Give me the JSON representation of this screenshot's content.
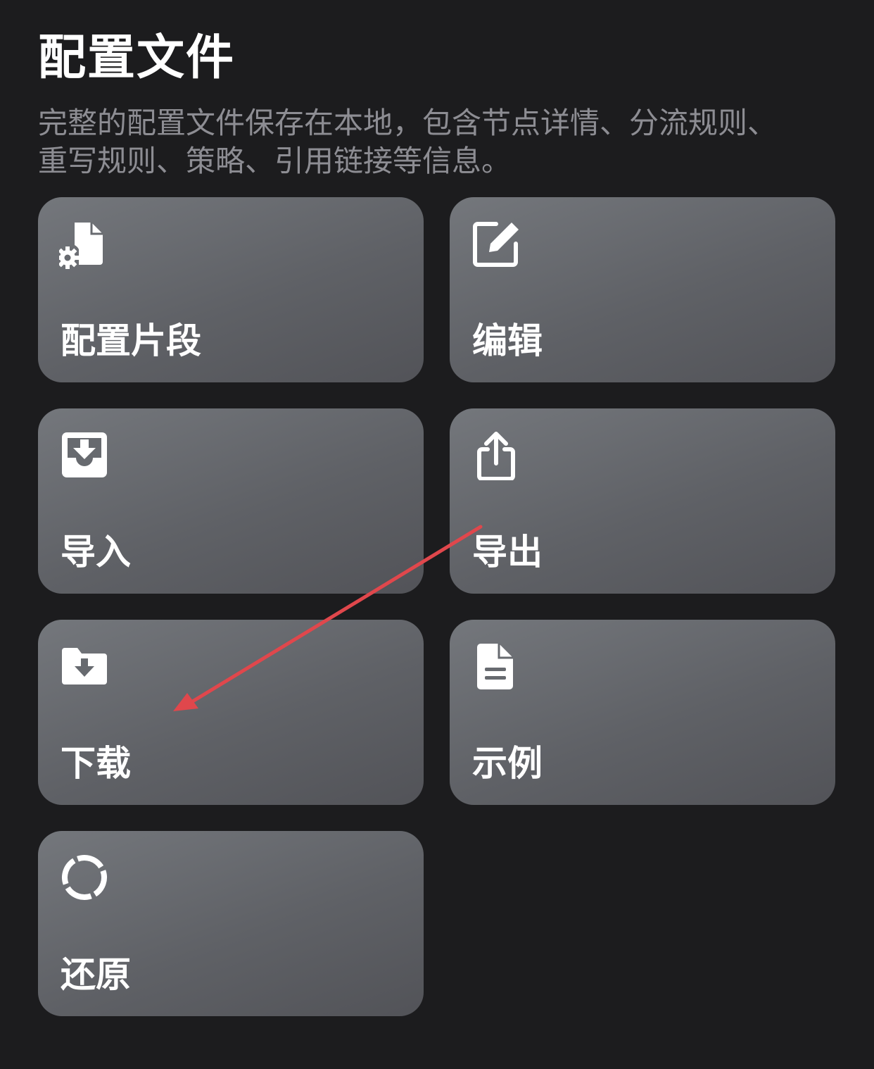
{
  "header": {
    "title": "配置文件",
    "description": "完整的配置文件保存在本地，包含节点详情、分流规则、重写规则、策略、引用链接等信息。"
  },
  "tiles": [
    {
      "label": "配置片段",
      "icon": "file-gear-icon"
    },
    {
      "label": "编辑",
      "icon": "edit-icon"
    },
    {
      "label": "导入",
      "icon": "tray-download-icon"
    },
    {
      "label": "导出",
      "icon": "share-icon"
    },
    {
      "label": "下载",
      "icon": "folder-download-icon"
    },
    {
      "label": "示例",
      "icon": "document-icon"
    },
    {
      "label": "还原",
      "icon": "dashed-circle-icon"
    }
  ],
  "colors": {
    "background": "#1c1c1e",
    "tile": "#67696e",
    "description_text": "#8d8d93",
    "annotation_arrow": "#e0474c"
  }
}
